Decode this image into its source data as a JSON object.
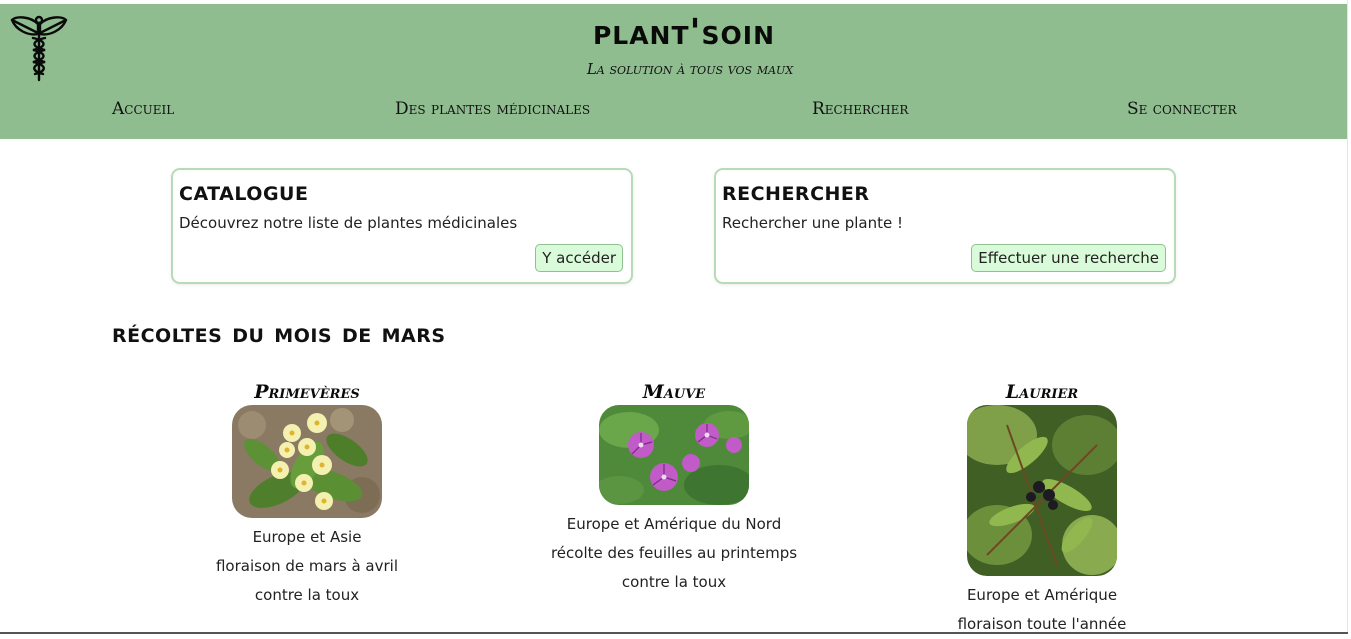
{
  "header": {
    "title": "plant'soin",
    "subtitle": "La solution à tous vos maux",
    "logo_icon": "caduceus-leaf-icon",
    "background_color": "#8fbd8f"
  },
  "nav": {
    "items": [
      "Accueil",
      "Des plantes médicinales",
      "Rechercher",
      "Se connecter"
    ]
  },
  "cards": [
    {
      "title": "catalogue",
      "text": "Découvrez notre liste de plantes médicinales",
      "button": "Y accéder"
    },
    {
      "title": "rechercher",
      "text": "Rechercher une plante !",
      "button": "Effectuer une recherche"
    }
  ],
  "harvest": {
    "title": "récoltes du mois de mars",
    "plants": [
      {
        "name": "Primevères",
        "lines": [
          "Europe et Asie",
          "floraison de mars à avril",
          "contre la toux"
        ],
        "image": "yellow-primrose-flowers"
      },
      {
        "name": "Mauve",
        "lines": [
          "Europe et Amérique du Nord",
          "récolte des feuilles au printemps",
          "contre la toux"
        ],
        "image": "purple-mallow-flowers"
      },
      {
        "name": "Laurier",
        "lines": [
          "Europe et Amérique",
          "floraison toute l'année"
        ],
        "image": "laurel-leaves-berries"
      }
    ]
  },
  "colors": {
    "accent_green": "#8fbd8f",
    "button_bg": "#d9fbd9",
    "card_border": "#b7dbb7"
  }
}
